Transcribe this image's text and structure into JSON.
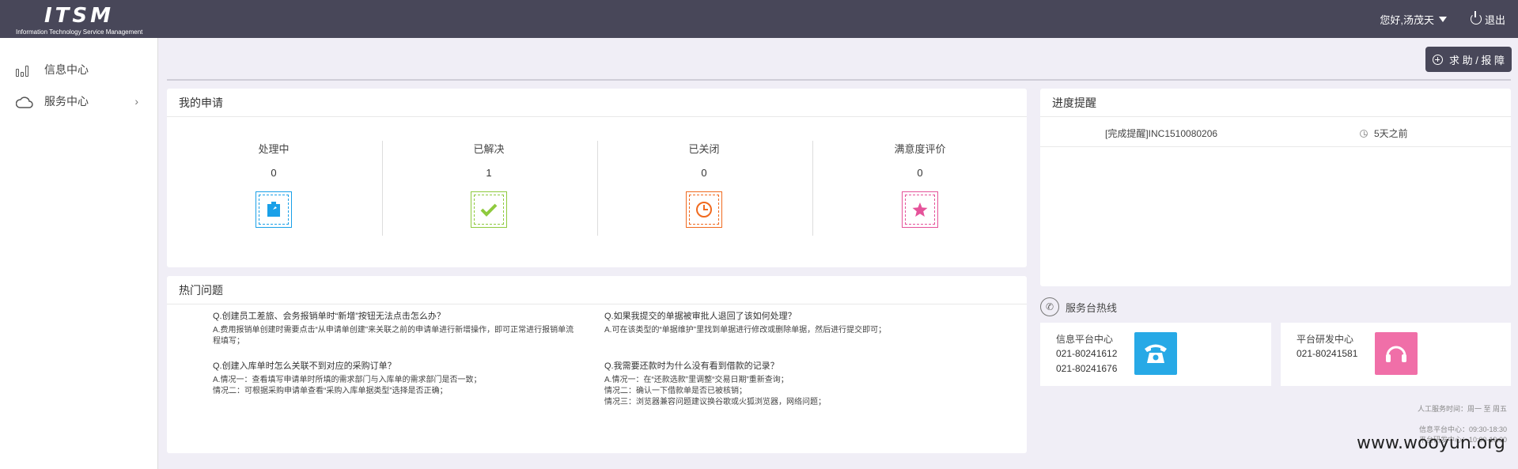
{
  "header": {
    "logo_text": "ITSM",
    "logo_tagline": "Information Technology Service Management",
    "user_greeting": "您好,汤茂天",
    "logout_label": "退出"
  },
  "sidebar": {
    "items": [
      {
        "label": "信息中心",
        "icon": "bar-chart-icon"
      },
      {
        "label": "服务中心",
        "icon": "cloud-icon",
        "has_submenu": true
      }
    ]
  },
  "toolbar": {
    "help_button": "求 助 / 报 障"
  },
  "my_requests": {
    "title": "我的申请",
    "stats": [
      {
        "label": "处理中",
        "count": "0",
        "color": "#1aa0e8",
        "icon": "document-icon"
      },
      {
        "label": "已解决",
        "count": "1",
        "color": "#8fca3e",
        "icon": "check-icon"
      },
      {
        "label": "已关闭",
        "count": "0",
        "color": "#f06a1f",
        "icon": "closed-clock-icon"
      },
      {
        "label": "满意度评价",
        "count": "0",
        "color": "#e5539a",
        "icon": "star-icon"
      }
    ]
  },
  "hot_questions": {
    "title": "热门问题",
    "items": [
      {
        "q": "Q.创建员工差旅、会务报销单时“新增”按钮无法点击怎么办？",
        "a": [
          "A.费用报销单创建时需要点击“从申请单创建”来关联之前的申请单进行新增操作，即可正常进行报销单流",
          "程填写；"
        ]
      },
      {
        "q": "Q.如果我提交的单据被审批人退回了该如何处理？",
        "a": [
          "A.可在该类型的“单据维护”里找到单据进行修改或删除单据，然后进行提交即可；"
        ]
      },
      {
        "q": "Q.创建入库单时怎么关联不到对应的采购订单？",
        "a": [
          "A.情况一：查看填写申请单时所填的需求部门与入库单的需求部门是否一致；",
          "情况二：可根据采购申请单查看“采购入库单据类型”选择是否正确；"
        ]
      },
      {
        "q": "Q.我需要还款时为什么没有看到借款的记录？",
        "a": [
          "A.情况一：在“还款选款”里调整“交易日期”重新查询；",
          "情况二：确认一下借款单是否已被核销；",
          "情况三：浏览器兼容问题建议换谷歌或火狐浏览器，网络问题；"
        ]
      }
    ]
  },
  "progress": {
    "title": "进度提醒",
    "items": [
      {
        "text": "[完成提醒]INC1510080206",
        "time": "5天之前"
      }
    ]
  },
  "hotline": {
    "title": "服务台热线",
    "cards": [
      {
        "name": "信息平台中心",
        "numbers": [
          "021-80241612",
          "021-80241676"
        ],
        "color": "#27a9e6",
        "icon": "telephone-icon"
      },
      {
        "name": "平台研发中心",
        "numbers": [
          "021-80241581"
        ],
        "color": "#f06fa8",
        "icon": "headset-icon"
      }
    ],
    "hours": [
      "人工服务时间：周一 至 周五",
      "信息平台中心：09:30-18:30",
      "平台研发中心：10:00-19:00"
    ]
  },
  "watermark": "www.wooyun.org"
}
